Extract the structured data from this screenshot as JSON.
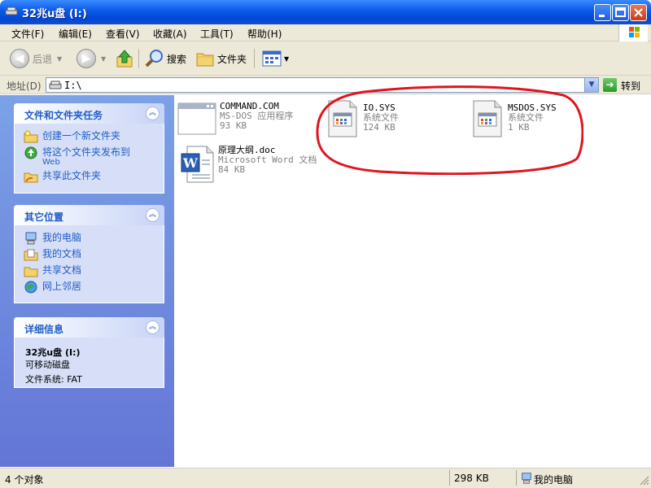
{
  "window": {
    "title": "32兆u盘 (I:)"
  },
  "menu": [
    "文件(F)",
    "编辑(E)",
    "查看(V)",
    "收藏(A)",
    "工具(T)",
    "帮助(H)"
  ],
  "toolbar": {
    "back": "后退",
    "search": "搜索",
    "folders": "文件夹"
  },
  "address": {
    "label": "地址(D)",
    "value": "I:\\",
    "go": "转到"
  },
  "tasks": {
    "title": "文件和文件夹任务",
    "items": [
      {
        "label": "创建一个新文件夹",
        "sub": ""
      },
      {
        "label": "将这个文件夹发布到",
        "sub": "Web"
      },
      {
        "label": "共享此文件夹",
        "sub": ""
      }
    ]
  },
  "places": {
    "title": "其它位置",
    "items": [
      "我的电脑",
      "我的文档",
      "共享文档",
      "网上邻居"
    ]
  },
  "details": {
    "title": "详细信息",
    "name": "32兆u盘 (I:)",
    "type": "可移动磁盘",
    "fs": "文件系统: FAT"
  },
  "files": [
    {
      "name": "COMMAND.COM",
      "desc": "MS-DOS 应用程序",
      "size": "93 KB"
    },
    {
      "name": "IO.SYS",
      "desc": "系统文件",
      "size": "124 KB"
    },
    {
      "name": "MSDOS.SYS",
      "desc": "系统文件",
      "size": "1 KB"
    },
    {
      "name": "原理大纲.doc",
      "desc": "Microsoft Word 文档",
      "size": "84 KB"
    }
  ],
  "status": {
    "count": "4 个对象",
    "size": "298 KB",
    "location": "我的电脑"
  },
  "colors": {
    "title_blue": "#0a58e8",
    "link_blue": "#215dc6",
    "highlight_red": "#e0141e"
  }
}
